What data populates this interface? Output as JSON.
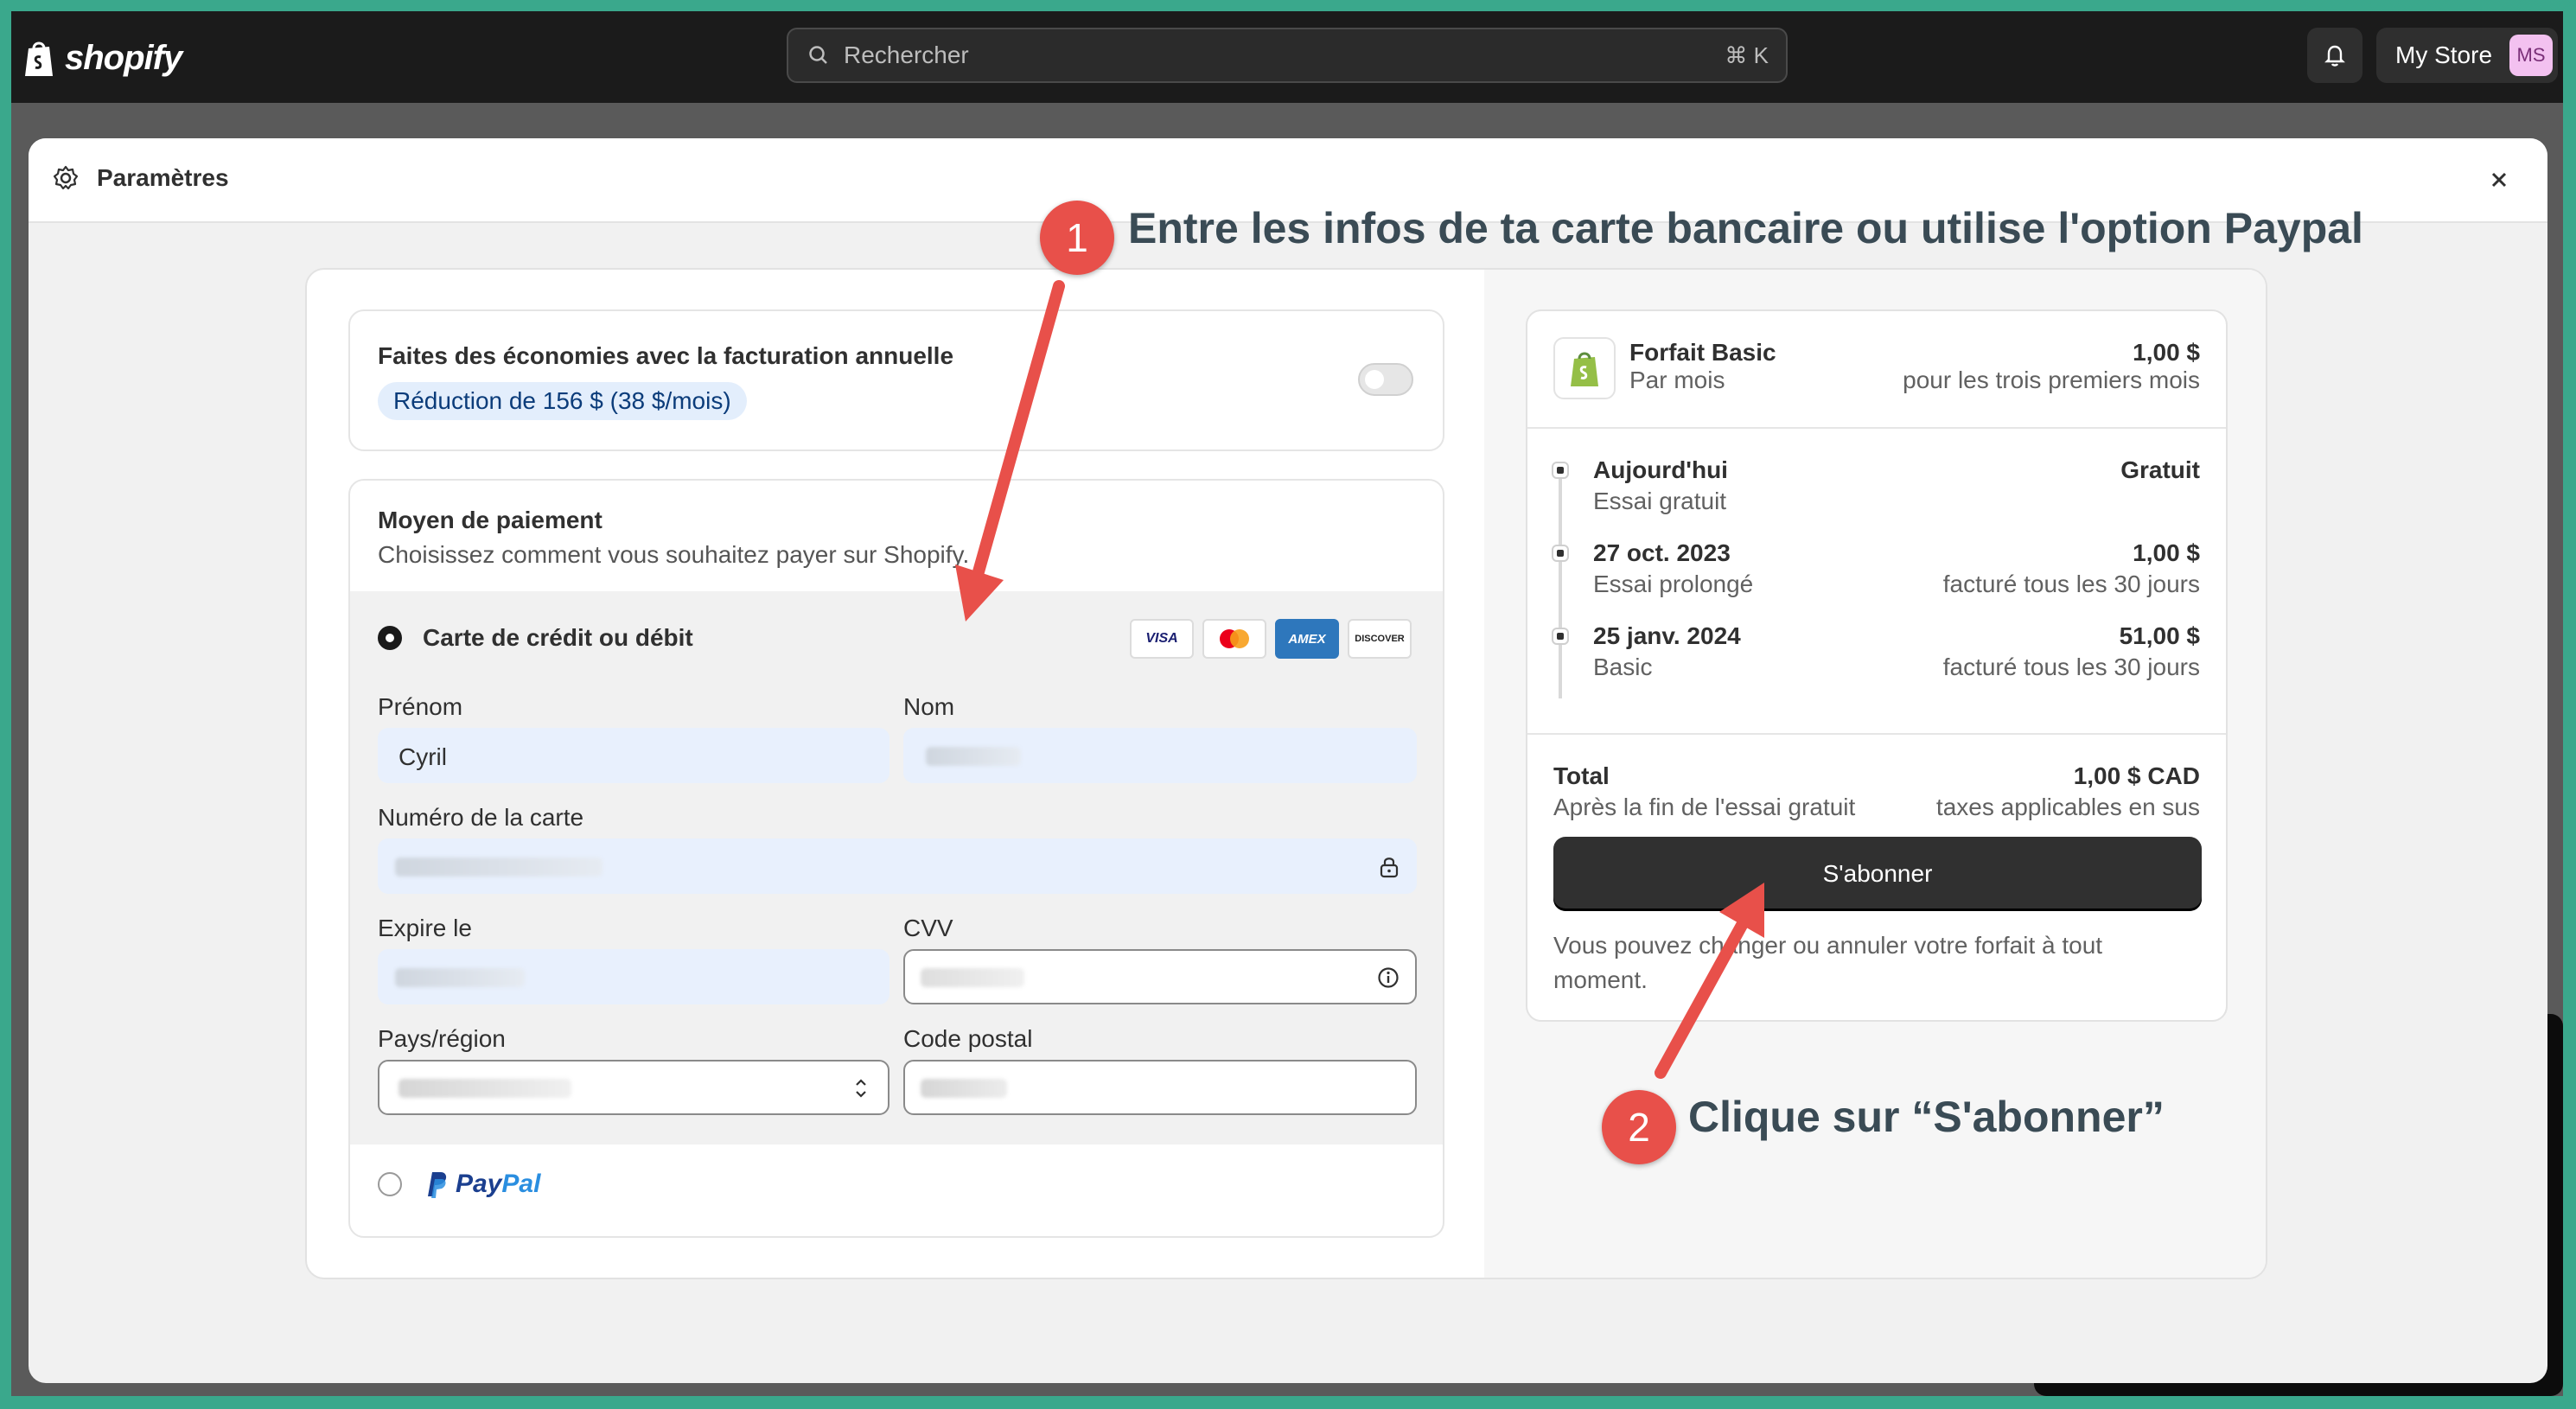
{
  "topbar": {
    "logo_text": "shopify",
    "search_placeholder": "Rechercher",
    "search_shortcut": "⌘ K",
    "store_name": "My Store",
    "avatar_initials": "MS"
  },
  "modal": {
    "title": "Paramètres"
  },
  "annual_billing": {
    "heading": "Faites des économies avec la facturation annuelle",
    "badge": "Réduction de 156 $ (38 $/mois)"
  },
  "payment": {
    "heading": "Moyen de paiement",
    "subtitle": "Choisissez comment vous souhaitez payer sur Shopify.",
    "credit_option": "Carte de crédit ou débit",
    "card_brands": [
      "VISA",
      "MC",
      "AMEX",
      "DISCOVER"
    ],
    "first_name_label": "Prénom",
    "first_name_value": "Cyril",
    "last_name_label": "Nom",
    "card_number_label": "Numéro de la carte",
    "expiry_label": "Expire le",
    "cvv_label": "CVV",
    "country_label": "Pays/région",
    "postal_label": "Code postal",
    "paypal_pay": "Pay",
    "paypal_pal": "Pal"
  },
  "summary": {
    "plan_name": "Forfait Basic",
    "plan_period": "Par mois",
    "plan_price": "1,00 $",
    "plan_price_note": "pour les trois premiers mois",
    "timeline": [
      {
        "date": "Aujourd'hui",
        "desc": "Essai gratuit",
        "amount": "Gratuit",
        "note": ""
      },
      {
        "date": "27 oct. 2023",
        "desc": "Essai prolongé",
        "amount": "1,00 $",
        "note": "facturé tous les 30 jours"
      },
      {
        "date": "25 janv. 2024",
        "desc": "Basic",
        "amount": "51,00 $",
        "note": "facturé tous les 30 jours"
      }
    ],
    "total_label": "Total",
    "total_sub": "Après la fin de l'essai gratuit",
    "total_amount": "1,00 $ CAD",
    "total_tax": "taxes applicables en sus",
    "subscribe_label": "S'abonner",
    "footnote": "Vous pouvez changer ou annuler votre forfait à tout moment."
  },
  "annotations": {
    "step1_number": "1",
    "step1_text": "Entre les infos de ta carte bancaire ou utilise l'option Paypal",
    "step2_number": "2",
    "step2_text": "Clique sur “S'abonner”"
  },
  "colors": {
    "annotation_red": "#e8504a",
    "badge_bg": "#e3eefc",
    "subscribe_bg": "#303030",
    "outer_border": "#3aa88c"
  }
}
